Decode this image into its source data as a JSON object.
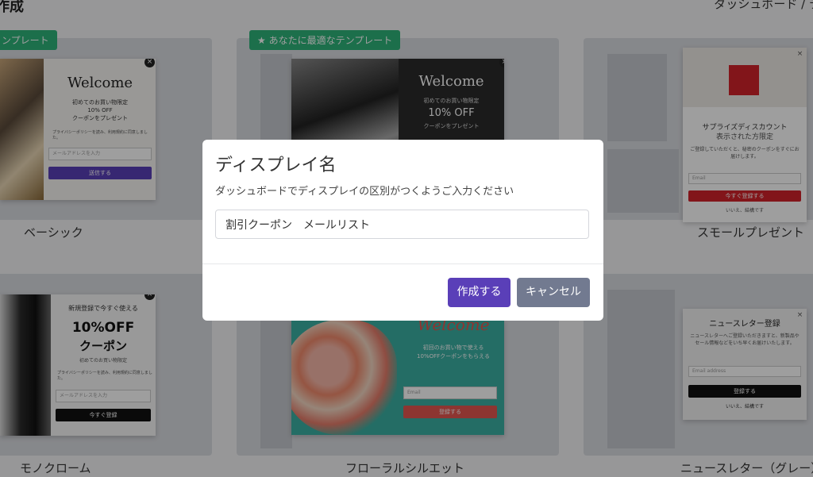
{
  "header": {
    "page_title": "作成",
    "breadcrumb": "ダッシュボード / テ"
  },
  "badges": {
    "left": "ンプレート",
    "center": "★ あなたに最適なテンプレート"
  },
  "templates": {
    "basic": {
      "label": "ベーシック",
      "title": "Welcome",
      "line1": "初めてのお買い物限定",
      "line2": "10% OFF",
      "line3": "クーポンをプレゼント",
      "consent": "プライバシーポリシーを読み、利用規約に同意しました。",
      "email_placeholder": "メールアドレスを入力",
      "button": "送信する"
    },
    "featured": {
      "title": "Welcome",
      "line1": "初めてのお買い物限定",
      "line2": "10% OFF",
      "line3": "クーポンをプレゼント"
    },
    "small_present": {
      "label": "スモールプレゼント",
      "title": "サプライズディスカウント",
      "subtitle": "表示された方限定",
      "body": "ご登録していただくと、秘密のクーポンをすぐにお届けします。",
      "email_placeholder": "Email",
      "button": "今すぐ登録する",
      "decline": "いいえ、結構です"
    },
    "monochrome": {
      "label": "モノクローム",
      "line1": "新規登録で今すぐ使える",
      "line2": "10%OFF",
      "line3": "クーポン",
      "line4": "初めてのお買い物限定",
      "consent": "プライバシーポリシーを読み、利用規約に同意しました。",
      "email_placeholder": "メールアドレスを入力",
      "button": "今すぐ登録"
    },
    "floral": {
      "label": "フローラルシルエット",
      "title": "Welcome",
      "line1": "初回のお買い物で使える",
      "line2": "10%OFFクーポンをもらえる",
      "email_placeholder": "Email",
      "button": "登録する"
    },
    "newsletter": {
      "label": "ニュースレター（グレー）",
      "title": "ニュースレター登録",
      "body": "ニュースレターへご登録いただきますと、新製品やセール情報などをいち早くお届けいたします。",
      "email_placeholder": "Email address",
      "button": "登録する",
      "decline": "いいえ、結構です"
    }
  },
  "modal": {
    "title": "ディスプレイ名",
    "description": "ダッシュボードでディスプレイの区別がつくようご入力ください",
    "input_value": "割引クーポン　メールリスト",
    "create_button": "作成する",
    "cancel_button": "キャンセル"
  },
  "colors": {
    "primary": "#5a3fb8",
    "secondary": "#727a90",
    "badge_green": "#2eb37a",
    "overlay": "rgba(0,0,0,0.38)"
  }
}
